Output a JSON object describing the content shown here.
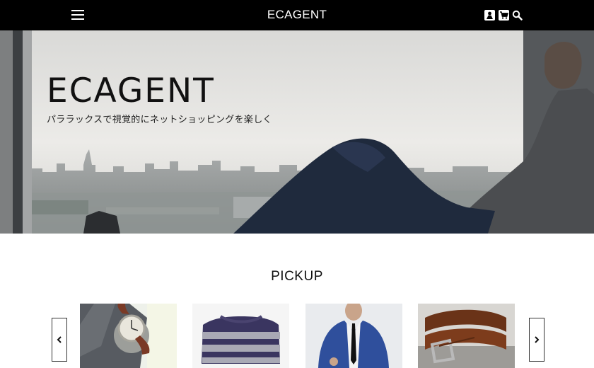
{
  "header": {
    "title": "ECAGENT",
    "menu_icon": "hamburger-menu-icon",
    "icons": [
      "user-icon",
      "cart-icon",
      "search-icon"
    ]
  },
  "hero": {
    "logo": "ECAGENT",
    "tagline": "パララックスで視覚的にネットショッピングを楽しく"
  },
  "pickup": {
    "heading": "PICKUP",
    "prev_icon": "chevron-left-icon",
    "next_icon": "chevron-right-icon",
    "products": [
      {
        "image": "wristwatch-image"
      },
      {
        "image": "striped-sweater-image"
      },
      {
        "image": "blue-suit-image"
      },
      {
        "image": "leather-belt-image"
      }
    ]
  }
}
